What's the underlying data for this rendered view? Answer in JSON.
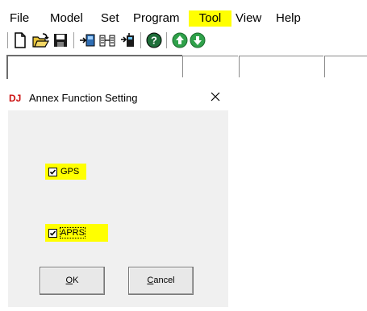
{
  "menubar": {
    "items": [
      {
        "label": "File"
      },
      {
        "label": "Model"
      },
      {
        "label": "Set"
      },
      {
        "label": "Program"
      },
      {
        "label": "Tool"
      },
      {
        "label": "View"
      },
      {
        "label": "Help"
      }
    ],
    "highlighted_item": "Tool",
    "highlight_color": "#ffff00"
  },
  "toolbar": {
    "buttons": [
      {
        "icon": "new-file-icon"
      },
      {
        "icon": "open-folder-icon"
      },
      {
        "icon": "save-disk-icon"
      },
      {
        "icon": "read-from-radio-icon"
      },
      {
        "icon": "write-to-radio-icon"
      },
      {
        "icon": "clone-radio-icon"
      },
      {
        "icon": "help-icon"
      },
      {
        "icon": "move-up-icon"
      },
      {
        "icon": "move-down-icon"
      }
    ]
  },
  "dialog": {
    "logo": "DJ",
    "title": "Annex Function Setting",
    "close_glyph": "✕",
    "checkboxes": [
      {
        "label": "GPS",
        "checked": true
      },
      {
        "label": "APRS",
        "checked": true
      }
    ],
    "ok_mnemonic": "O",
    "ok_rest": "K",
    "cancel_mnemonic": "C",
    "cancel_rest": "ancel",
    "logo_color": "#cc1111",
    "highlight_color": "#ffff00"
  }
}
